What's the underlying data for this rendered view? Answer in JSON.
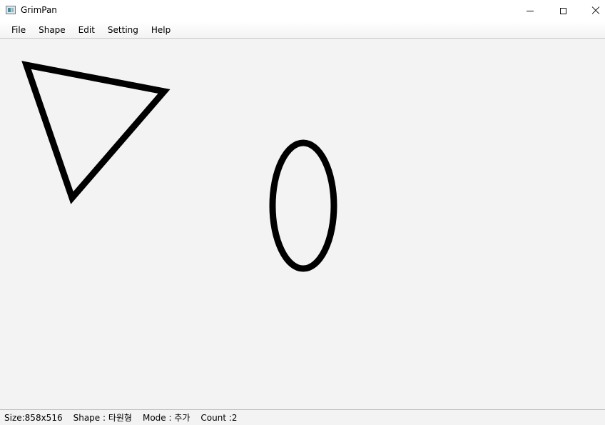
{
  "window": {
    "title": "GrimPan",
    "minimize_icon": "minimize-icon",
    "maximize_icon": "maximize-icon",
    "close_icon": "close-icon"
  },
  "menubar": {
    "items": [
      {
        "label": "File"
      },
      {
        "label": "Shape"
      },
      {
        "label": "Edit"
      },
      {
        "label": "Setting"
      },
      {
        "label": "Help"
      }
    ]
  },
  "canvas": {
    "background": "#f3f3f3",
    "stroke_color": "#000000",
    "shapes": [
      "triangle",
      "ellipse"
    ]
  },
  "statusbar": {
    "size": "Size:858x516",
    "shape": "Shape : 타원형",
    "mode": "Mode : 추가",
    "count": "Count :2"
  }
}
